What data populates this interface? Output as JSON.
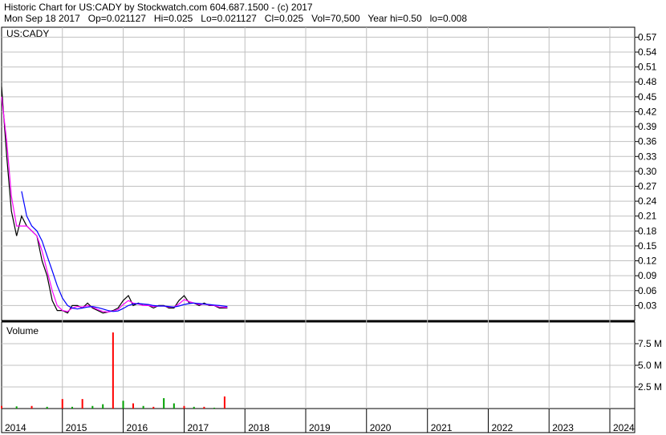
{
  "header": {
    "title": "Historic Chart for US:CADY by Stockwatch.com 604.687.1500 - (c) 2017",
    "stats": "Mon Sep 18 2017   Op=0.021127   Hi=0.025   Lo=0.021127   Cl=0.025   Vol=70,500   Year hi=0.50   lo=0.008"
  },
  "chart_data": [
    {
      "type": "line",
      "title": "US:CADY",
      "x": [
        "2014-01-01",
        "2014-02-01",
        "2014-03-01",
        "2014-04-01",
        "2014-05-01",
        "2014-06-01",
        "2014-07-01",
        "2014-08-01",
        "2014-09-01",
        "2014-10-01",
        "2014-11-01",
        "2014-12-01",
        "2015-01-01",
        "2015-02-01",
        "2015-03-01",
        "2015-04-01",
        "2015-05-01",
        "2015-06-01",
        "2015-07-01",
        "2015-08-01",
        "2015-09-01",
        "2015-10-01",
        "2015-11-01",
        "2015-12-01",
        "2016-01-01",
        "2016-02-01",
        "2016-03-01",
        "2016-04-01",
        "2016-05-01",
        "2016-06-01",
        "2016-07-01",
        "2016-08-01",
        "2016-09-01",
        "2016-10-01",
        "2016-11-01",
        "2016-12-01",
        "2017-01-01",
        "2017-02-01",
        "2017-03-01",
        "2017-04-01",
        "2017-05-01",
        "2017-06-01",
        "2017-07-01",
        "2017-08-01",
        "2017-09-18"
      ],
      "series": [
        {
          "values": [
            0.47,
            0.33,
            0.22,
            0.17,
            0.21,
            0.19,
            0.18,
            0.17,
            0.12,
            0.09,
            0.04,
            0.02,
            0.02,
            0.015,
            0.03,
            0.03,
            0.025,
            0.035,
            0.025,
            0.02,
            0.015,
            0.017,
            0.02,
            0.025,
            0.04,
            0.05,
            0.03,
            0.035,
            0.03,
            0.03,
            0.025,
            0.03,
            0.03,
            0.025,
            0.025,
            0.04,
            0.05,
            0.035,
            0.035,
            0.03,
            0.035,
            0.03,
            0.03,
            0.025,
            0.025
          ],
          "color": "#000000"
        },
        {
          "values": [
            0.45,
            0.36,
            0.25,
            0.19,
            0.19,
            0.19,
            0.18,
            0.17,
            0.14,
            0.1,
            0.06,
            0.03,
            0.02,
            0.018,
            0.025,
            0.028,
            0.027,
            0.03,
            0.027,
            0.022,
            0.018,
            0.017,
            0.019,
            0.022,
            0.032,
            0.04,
            0.035,
            0.033,
            0.03,
            0.03,
            0.028,
            0.029,
            0.029,
            0.027,
            0.027,
            0.033,
            0.042,
            0.038,
            0.035,
            0.032,
            0.033,
            0.031,
            0.03,
            0.027,
            0.026
          ],
          "color": "#ff00ff"
        },
        {
          "values": [
            null,
            null,
            null,
            null,
            0.26,
            0.21,
            0.19,
            0.18,
            0.16,
            0.13,
            0.1,
            0.07,
            0.045,
            0.03,
            0.025,
            0.023,
            0.025,
            0.027,
            0.028,
            0.026,
            0.023,
            0.02,
            0.018,
            0.019,
            0.024,
            0.03,
            0.033,
            0.034,
            0.033,
            0.032,
            0.03,
            0.029,
            0.029,
            0.028,
            0.027,
            0.029,
            0.032,
            0.034,
            0.035,
            0.034,
            0.033,
            0.032,
            0.031,
            0.03,
            0.028
          ],
          "color": "#0000ff"
        }
      ],
      "ylim": [
        0,
        0.59
      ],
      "yticks": [
        "0.03",
        "0.06",
        "0.09",
        "0.12",
        "0.15",
        "0.18",
        "0.21",
        "0.24",
        "0.27",
        "0.30",
        "0.33",
        "0.36",
        "0.39",
        "0.42",
        "0.45",
        "0.48",
        "0.51",
        "0.54",
        "0.57"
      ]
    },
    {
      "type": "bar",
      "title": "Volume",
      "x": [
        "2014-01",
        "2014-04",
        "2014-07",
        "2014-10",
        "2015-01",
        "2015-03",
        "2015-05",
        "2015-07",
        "2015-09",
        "2015-11",
        "2016-01",
        "2016-03",
        "2016-05",
        "2016-07",
        "2016-09",
        "2016-11",
        "2017-01",
        "2017-03",
        "2017-05",
        "2017-07",
        "2017-09"
      ],
      "values": [
        0.3,
        0.25,
        0.3,
        0.2,
        1.1,
        0.2,
        1.1,
        0.3,
        0.5,
        8.8,
        0.9,
        0.6,
        0.3,
        0.2,
        1.2,
        0.6,
        0.3,
        0.2,
        0.2,
        0.1,
        1.4
      ],
      "colors": [
        "#ff0000",
        "#00a000",
        "#ff0000",
        "#00a000",
        "#ff0000",
        "#00a000",
        "#ff0000",
        "#00a000",
        "#00a000",
        "#ff0000",
        "#00a000",
        "#ff0000",
        "#00a000",
        "#ff0000",
        "#00a000",
        "#00a000",
        "#ff0000",
        "#00a000",
        "#ff0000",
        "#00a000",
        "#ff0000"
      ],
      "ylim": [
        0,
        10
      ],
      "yticks": [
        "2.5 M",
        "5.0 M",
        "7.5 M"
      ]
    }
  ],
  "x_axis": {
    "labels": [
      "2014",
      "2015",
      "2016",
      "2017",
      "2018",
      "2019",
      "2020",
      "2021",
      "2022",
      "2023",
      "2024"
    ]
  },
  "colors": {
    "price": "#000000",
    "ma_short": "#ff00ff",
    "ma_long": "#0000ff",
    "up": "#00a000",
    "down": "#ff0000",
    "grid": "#c0c0c0"
  }
}
